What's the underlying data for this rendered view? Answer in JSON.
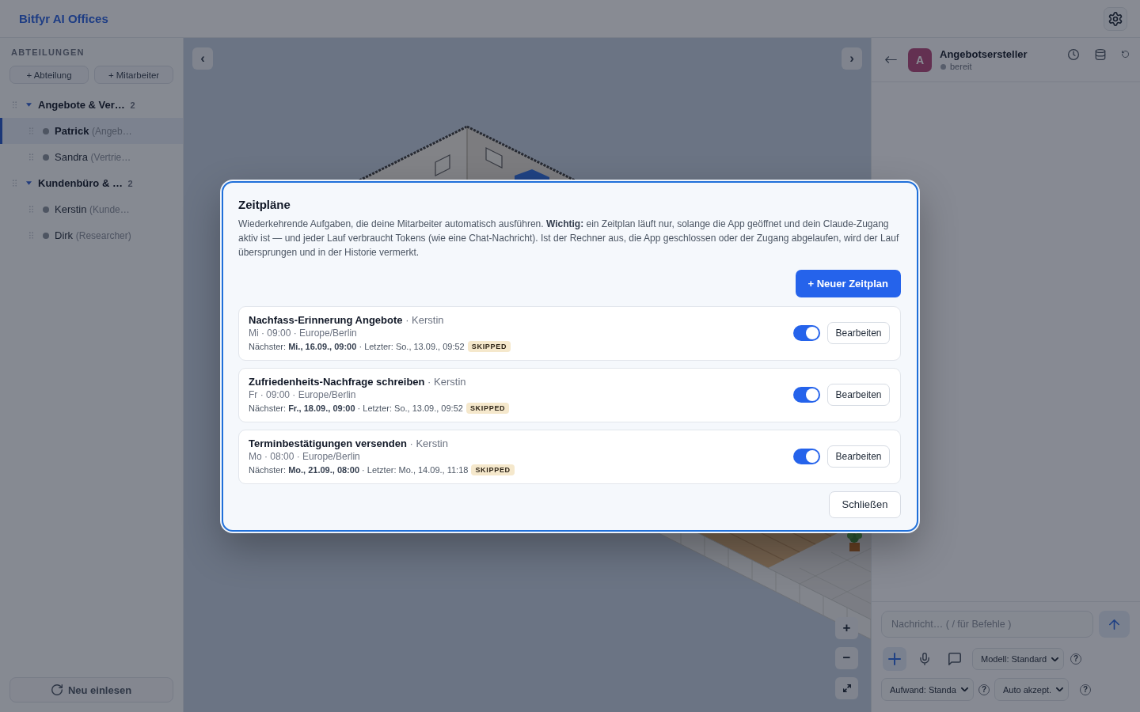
{
  "topbar": {
    "title": "Bitfyr AI Offices"
  },
  "sidebar": {
    "heading": "ABTEILUNGEN",
    "actions": [
      "+ Abteilung",
      "+ Mitarbeiter"
    ],
    "departments": [
      {
        "name": "Angebote & Ver…",
        "count": "2",
        "expanded": true,
        "children": [
          {
            "name": "Patrick",
            "role": "(Angeb…",
            "selected": true
          },
          {
            "name": "Sandra",
            "role": "(Vertrie…",
            "selected": false
          }
        ]
      },
      {
        "name": "Kundenbüro & …",
        "count": "2",
        "expanded": true,
        "children": [
          {
            "name": "Kerstin",
            "role": "(Kunde…",
            "selected": false
          },
          {
            "name": "Dirk",
            "role": "(Researcher)",
            "selected": false
          }
        ]
      }
    ],
    "reload_button": "Neu einlesen"
  },
  "map": {
    "prev_button": "‹",
    "next_button": "›",
    "zoom_in": "+",
    "zoom_out": "−"
  },
  "chat_panel": {
    "agent": {
      "initial": "A",
      "name": "Angebotsersteller",
      "status": "bereit"
    },
    "composer": {
      "placeholder": "Nachricht… ( / für Befehle )",
      "selects": [
        {
          "value": "Modell: Standard",
          "help": "?"
        },
        {
          "value": "Aufwand: Standa",
          "help": "?"
        },
        {
          "value": "Auto akzept.",
          "help": "?"
        }
      ]
    }
  },
  "modal": {
    "title": "Zeitpläne",
    "description": "Wiederkehrende Aufgaben, die deine Mitarbeiter automatisch ausführen. **Wichtig:** ein Zeitplan läuft nur, solange die App geöffnet und dein Claude-Zugang aktiv ist — und jeder Lauf verbraucht Tokens (wie eine Chat-Nachricht). Ist der Rechner aus, die App geschlossen oder der Zugang abgelaufen, wird der Lauf übersprungen und in der Historie vermerkt.",
    "new_button": "+ Neuer Zeitplan",
    "schedules": [
      {
        "heading": "**Nachfass-Erinnerung Angebote** · Kerstin",
        "when": "Mi · 09:00 · Europe/Berlin",
        "runs": "Nächster: **Mi., 16.09., 09:00** · Letzter: So., 13.09., 09:52",
        "last_status": "SKIPPED",
        "enabled": true,
        "edit_button": "Bearbeiten"
      },
      {
        "heading": "**Zufriedenheits-Nachfrage schreiben** · Kerstin",
        "when": "Fr · 09:00 · Europe/Berlin",
        "runs": "Nächster: **Fr., 18.09., 09:00** · Letzter: So., 13.09., 09:52",
        "last_status": "SKIPPED",
        "enabled": true,
        "edit_button": "Bearbeiten"
      },
      {
        "heading": "**Terminbestätigungen versenden** · Kerstin",
        "when": "Mo · 08:00 · Europe/Berlin",
        "runs": "Nächster: **Mo., 21.09., 08:00** · Letzter: Mo., 14.09., 11:18",
        "last_status": "SKIPPED",
        "enabled": true,
        "edit_button": "Bearbeiten"
      }
    ],
    "close_button": "Schließen"
  }
}
